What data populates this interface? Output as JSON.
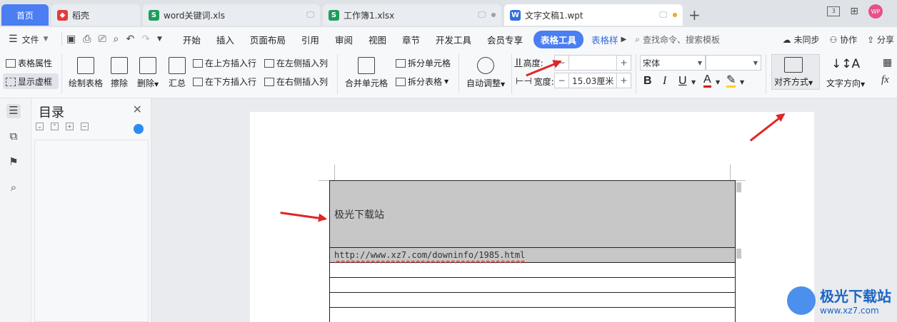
{
  "tabs": [
    {
      "label": "首页"
    },
    {
      "label": "稻壳"
    },
    {
      "label": "word关键词.xls"
    },
    {
      "label": "工作簿1.xlsx"
    },
    {
      "label": "文字文稿1.wpt"
    }
  ],
  "avatar_text": "WP",
  "menu": {
    "file": "文件",
    "items": [
      "开始",
      "插入",
      "页面布局",
      "引用",
      "审阅",
      "视图",
      "章节",
      "开发工具",
      "会员专享"
    ],
    "active_pill": "表格工具",
    "next_item": "表格样",
    "search": "查找命令、搜索模板",
    "sync": "未同步",
    "collab": "协作",
    "share": "分享"
  },
  "ribbon": {
    "table_props": "表格属性",
    "show_gridlines": "显示虚框",
    "draw_table": "绘制表格",
    "erase": "擦除",
    "delete": "删除",
    "summary": "汇总",
    "insert_above": "在上方插入行",
    "insert_below": "在下方插入行",
    "insert_left": "在左侧插入列",
    "insert_right": "在右侧插入列",
    "merge": "合并单元格",
    "split_cell": "拆分单元格",
    "split_table": "拆分表格",
    "auto_fit": "自动调整",
    "height_label": "高度:",
    "width_label": "宽度:",
    "width_value": "15.03厘米",
    "font_name": "宋体",
    "align": "对齐方式",
    "text_direction": "文字方向",
    "fx": "fx"
  },
  "toc": {
    "title": "目录"
  },
  "document": {
    "row1": "极光下载站",
    "row2": "http://www.xz7.com/downinfo/1985.html"
  },
  "watermark": {
    "name": "极光下载站",
    "url": "www.xz7.com"
  },
  "colors": {
    "accent": "#4a7ef2",
    "arrow": "#e02626",
    "cell_shade": "#c7c7c7"
  }
}
